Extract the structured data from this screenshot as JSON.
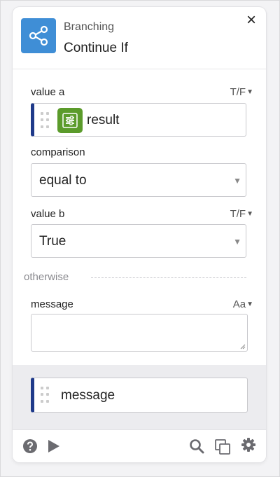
{
  "header": {
    "category": "Branching",
    "title": "Continue If",
    "close_glyph": "×",
    "icon": "share-nodes-icon",
    "icon_color": "#3f8ed6"
  },
  "fields": {
    "value_a": {
      "label": "value a",
      "type": "T/F",
      "token_label": "result",
      "token_icon": "sliders-icon",
      "token_icon_color": "#5b9b2b"
    },
    "comparison": {
      "label": "comparison",
      "value": "equal to"
    },
    "value_b": {
      "label": "value b",
      "type": "T/F",
      "value": "True"
    },
    "otherwise": {
      "label": "otherwise"
    },
    "message": {
      "label": "message",
      "type": "Aa",
      "value": ""
    }
  },
  "output": {
    "token_label": "message",
    "accent_color": "#1f3a8a"
  },
  "footer": {
    "left_icons": [
      "help-icon",
      "play-icon"
    ],
    "right_icons": [
      "search-icon",
      "duplicate-icon",
      "settings-gear-icon"
    ]
  }
}
